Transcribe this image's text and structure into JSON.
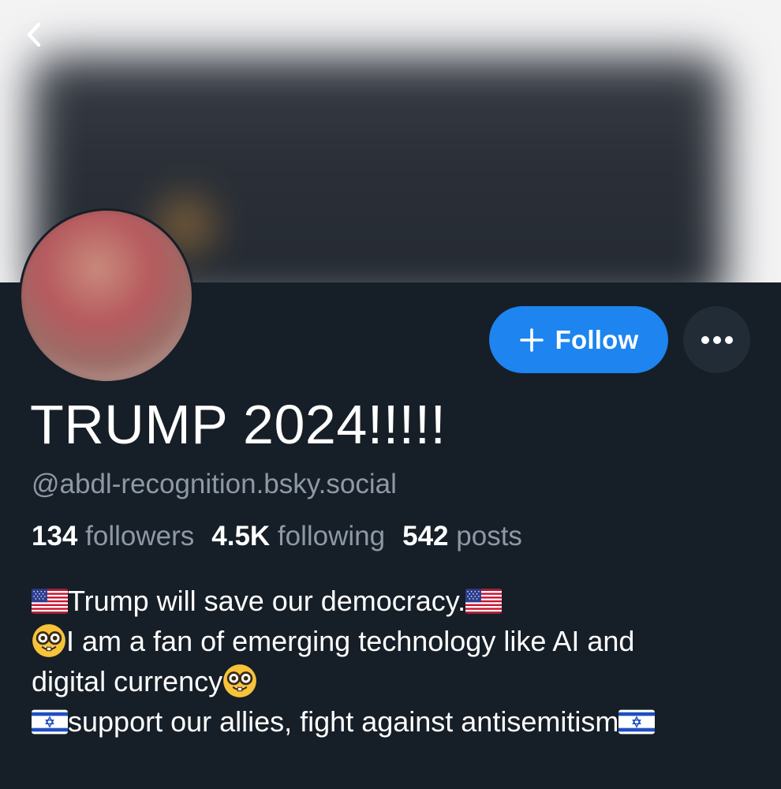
{
  "profile": {
    "display_name": "TRUMP 2024!!!!!",
    "handle": "@abdl-recognition.bsky.social",
    "stats": {
      "followers_count": "134",
      "followers_label": "followers",
      "following_count": "4.5K",
      "following_label": "following",
      "posts_count": "542",
      "posts_label": "posts"
    },
    "bio": {
      "line1": "Trump will save our democracy.",
      "line2a": "I am a fan of emerging technology like AI and",
      "line2b": "digital currency",
      "line3": "support our allies, fight against antisemitism"
    }
  },
  "actions": {
    "follow_label": "Follow"
  },
  "icons": {
    "back": "chevron-left-icon",
    "plus": "plus-icon",
    "more": "ellipsis-icon",
    "us_flag": "us-flag-icon",
    "nerd_face": "nerd-face-icon",
    "israel_flag": "israel-flag-icon"
  },
  "colors": {
    "background": "#161e27",
    "accent": "#1d84f0",
    "muted_text": "#8e99a6",
    "more_button_bg": "#222c37"
  }
}
